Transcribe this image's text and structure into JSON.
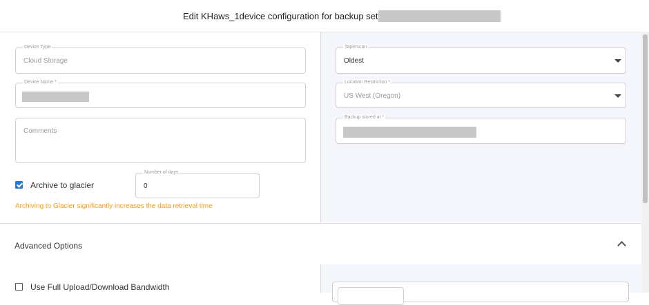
{
  "dialog": {
    "title": "Edit KHaws_1device configuration for backup set :"
  },
  "left": {
    "device_type": {
      "label": "Device Type",
      "value": "Cloud Storage"
    },
    "device_name": {
      "label": "Device Name *"
    },
    "comments": {
      "placeholder": "Comments"
    },
    "archive": {
      "label": "Archive to glacier",
      "checked": true
    },
    "number_of_days": {
      "label": "Number of days",
      "value": "0"
    },
    "warning": "Archiving to Glacier significantly increases the data retrieval time"
  },
  "right": {
    "taperscan": {
      "label": "Taperscan",
      "value": "Oldest"
    },
    "location_restriction": {
      "label": "Location Restriction *",
      "value": "US West (Oregon)"
    },
    "backup_stored_at": {
      "label": "Backup stored at *"
    }
  },
  "advanced": {
    "label": "Advanced Options",
    "bandwidth": {
      "label": "Use Full Upload/Download Bandwidth",
      "checked": false
    }
  },
  "colors": {
    "accent": "#1e7bd6",
    "warning": "#f39c1f",
    "panel_bg": "#f4f6fb"
  },
  "icons": [
    "chevron-up-icon",
    "dropdown-caret-icon",
    "checkbox-icon"
  ]
}
